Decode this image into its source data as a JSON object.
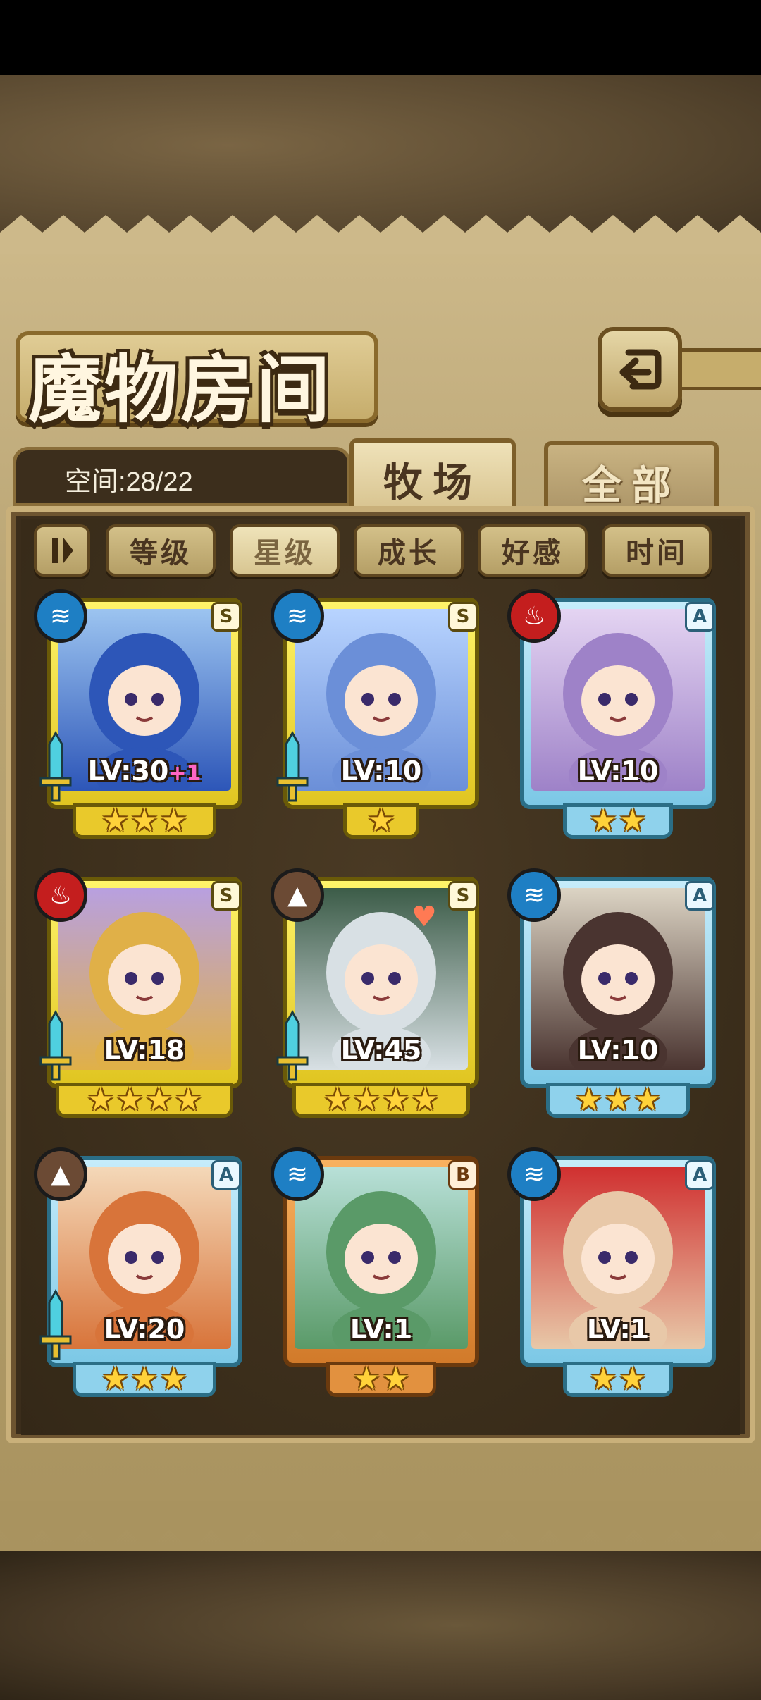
{
  "title": "魔物房间",
  "capacity": "空间:28/22",
  "tabs": [
    {
      "label": "牧场",
      "active": true
    },
    {
      "label": "全部",
      "active": false
    }
  ],
  "sort_buttons": [
    {
      "label": "等级",
      "active": false
    },
    {
      "label": "星级",
      "active": true
    },
    {
      "label": "成长",
      "active": false
    },
    {
      "label": "好感",
      "active": false
    },
    {
      "label": "时间",
      "active": false
    }
  ],
  "icons": {
    "back": "return-arrow-icon",
    "pause": "pause-icon",
    "water": "water-element-icon",
    "fire": "fire-element-icon",
    "earth": "earth-element-icon",
    "weapon": "sword-icon",
    "star": "star-icon",
    "heart": "heart-icon"
  },
  "colors": {
    "gold_frame": "#f2db3a",
    "blue_frame": "#8fd2ec",
    "orange_frame": "#e2913f",
    "water": "#1e7fc4",
    "fire": "#c41e1e",
    "earth": "#6b4a34",
    "level_bonus": "#ff66c4"
  },
  "monsters": [
    {
      "level": "LV:30",
      "bonus": "+1",
      "stars": 3,
      "rank": "S",
      "element": "water",
      "frame": "gold",
      "weapon": true,
      "heart": false,
      "art": [
        "#2d56b8",
        "#9cc4f0"
      ]
    },
    {
      "level": "LV:10",
      "bonus": "",
      "stars": 1,
      "rank": "S",
      "element": "water",
      "frame": "gold",
      "weapon": true,
      "heart": false,
      "art": [
        "#6b8fd8",
        "#b8d4ff"
      ]
    },
    {
      "level": "LV:10",
      "bonus": "",
      "stars": 2,
      "rank": "A",
      "element": "fire",
      "frame": "blue",
      "weapon": false,
      "heart": false,
      "art": [
        "#9e82c8",
        "#e4d4f2"
      ]
    },
    {
      "level": "LV:18",
      "bonus": "",
      "stars": 4,
      "rank": "S",
      "element": "fire",
      "frame": "gold",
      "weapon": true,
      "heart": false,
      "art": [
        "#e0b048",
        "#b8a0e0"
      ]
    },
    {
      "level": "LV:45",
      "bonus": "",
      "stars": 4,
      "rank": "S",
      "element": "earth",
      "frame": "gold",
      "weapon": true,
      "heart": true,
      "art": [
        "#d8e0e4",
        "#3c5c48"
      ]
    },
    {
      "level": "LV:10",
      "bonus": "",
      "stars": 3,
      "rank": "A",
      "element": "water",
      "frame": "blue",
      "weapon": false,
      "heart": false,
      "art": [
        "#4a3430",
        "#dcd4c4"
      ]
    },
    {
      "level": "LV:20",
      "bonus": "",
      "stars": 3,
      "rank": "A",
      "element": "earth",
      "frame": "blue",
      "weapon": true,
      "heart": false,
      "art": [
        "#d8743a",
        "#f4d8b8"
      ]
    },
    {
      "level": "LV:1",
      "bonus": "",
      "stars": 2,
      "rank": "B",
      "element": "water",
      "frame": "orange",
      "weapon": false,
      "heart": false,
      "art": [
        "#5a9a68",
        "#b8e0d8"
      ]
    },
    {
      "level": "LV:1",
      "bonus": "",
      "stars": 2,
      "rank": "A",
      "element": "water",
      "frame": "blue",
      "weapon": false,
      "heart": false,
      "art": [
        "#e8c8a8",
        "#d03030"
      ]
    }
  ]
}
